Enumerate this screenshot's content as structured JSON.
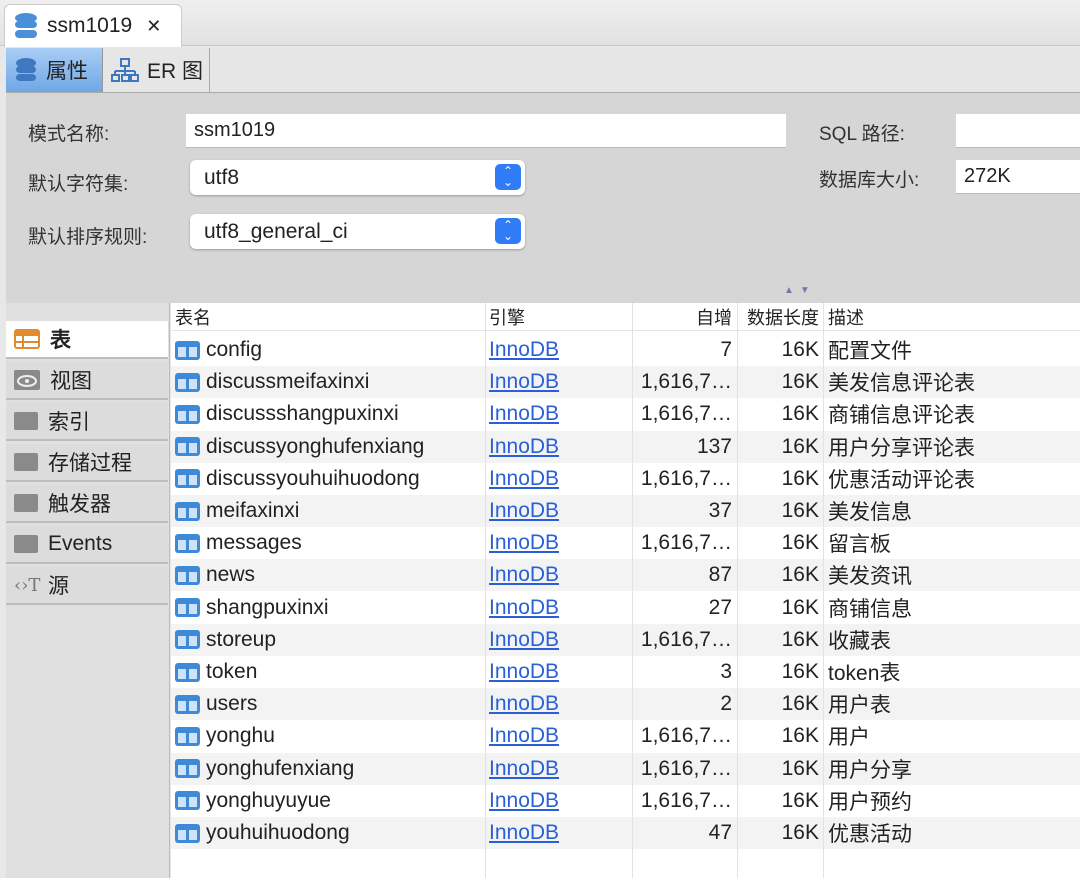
{
  "window_tab": {
    "title": "ssm1019",
    "close_icon": "close-icon"
  },
  "subtabs": [
    {
      "label": "属性"
    },
    {
      "label": "ER 图"
    }
  ],
  "form": {
    "schema_name_label": "模式名称:",
    "schema_name": "ssm1019",
    "charset_label": "默认字符集:",
    "charset": "utf8",
    "collation_label": "默认排序规则:",
    "collation": "utf8_general_ci",
    "sql_path_label": "SQL 路径:",
    "sql_path": "",
    "db_size_label": "数据库大小:",
    "db_size": "272K"
  },
  "sidebar": {
    "items": [
      {
        "label": "表",
        "icon": "table-icon"
      },
      {
        "label": "视图",
        "icon": "eye-icon"
      },
      {
        "label": "索引",
        "icon": "folder-icon"
      },
      {
        "label": "存储过程",
        "icon": "folder-icon"
      },
      {
        "label": "触发器",
        "icon": "folder-icon"
      },
      {
        "label": "Events",
        "icon": "folder-icon"
      },
      {
        "label": "源",
        "icon": "source-icon"
      }
    ]
  },
  "table": {
    "columns": [
      "表名",
      "引擎",
      "自增",
      "数据长度",
      "描述"
    ],
    "rows": [
      [
        "config",
        "InnoDB",
        "7",
        "16K",
        "配置文件"
      ],
      [
        "discussmeifaxinxi",
        "InnoDB",
        "1,616,7…",
        "16K",
        "美发信息评论表"
      ],
      [
        "discussshangpuxinxi",
        "InnoDB",
        "1,616,7…",
        "16K",
        "商铺信息评论表"
      ],
      [
        "discussyonghufenxiang",
        "InnoDB",
        "137",
        "16K",
        "用户分享评论表"
      ],
      [
        "discussyouhuihuodong",
        "InnoDB",
        "1,616,7…",
        "16K",
        "优惠活动评论表"
      ],
      [
        "meifaxinxi",
        "InnoDB",
        "37",
        "16K",
        "美发信息"
      ],
      [
        "messages",
        "InnoDB",
        "1,616,7…",
        "16K",
        "留言板"
      ],
      [
        "news",
        "InnoDB",
        "87",
        "16K",
        "美发资讯"
      ],
      [
        "shangpuxinxi",
        "InnoDB",
        "27",
        "16K",
        "商铺信息"
      ],
      [
        "storeup",
        "InnoDB",
        "1,616,7…",
        "16K",
        "收藏表"
      ],
      [
        "token",
        "InnoDB",
        "3",
        "16K",
        "token表"
      ],
      [
        "users",
        "InnoDB",
        "2",
        "16K",
        "用户表"
      ],
      [
        "yonghu",
        "InnoDB",
        "1,616,7…",
        "16K",
        "用户"
      ],
      [
        "yonghufenxiang",
        "InnoDB",
        "1,616,7…",
        "16K",
        "用户分享"
      ],
      [
        "yonghuyuyue",
        "InnoDB",
        "1,616,7…",
        "16K",
        "用户预约"
      ],
      [
        "youhuihuodong",
        "InnoDB",
        "47",
        "16K",
        "优惠活动"
      ]
    ]
  }
}
